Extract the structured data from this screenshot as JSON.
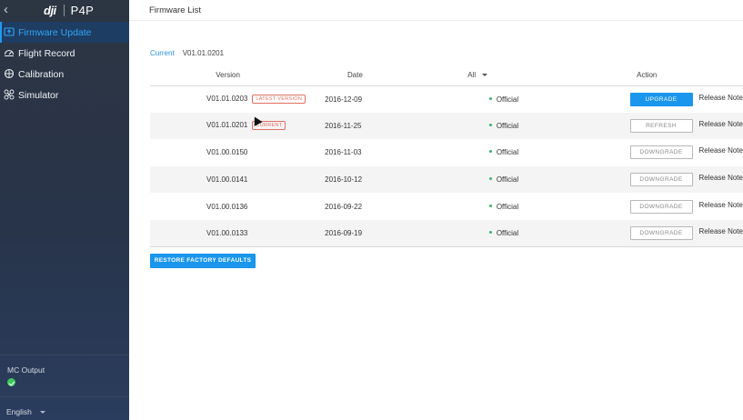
{
  "sidebar": {
    "brand_logo": "dji",
    "brand_model": "P4P",
    "nav": [
      {
        "label": "Firmware Update",
        "icon": "firmware-icon",
        "active": true
      },
      {
        "label": "Flight Record",
        "icon": "flight-record-icon",
        "active": false
      },
      {
        "label": "Calibration",
        "icon": "calibration-icon",
        "active": false
      },
      {
        "label": "Simulator",
        "icon": "simulator-icon",
        "active": false
      }
    ],
    "mc_output_label": "MC Output",
    "language": "English"
  },
  "main": {
    "title": "Firmware List",
    "current_label": "Current",
    "current_version": "V01.01.0201",
    "columns": {
      "version": "Version",
      "date": "Date",
      "filter": "All",
      "action": "Action"
    },
    "rows": [
      {
        "version": "V01.01.0203",
        "badge": "LATEST VERSION",
        "date": "2016-12-09",
        "type": "Official",
        "action": "UPGRADE",
        "note": "Release Note"
      },
      {
        "version": "V01.01.0201",
        "badge": "CURRENT",
        "date": "2016-11-25",
        "type": "Official",
        "action": "REFRESH",
        "note": "Release Note"
      },
      {
        "version": "V01.00.0150",
        "badge": "",
        "date": "2016-11-03",
        "type": "Official",
        "action": "DOWNGRADE",
        "note": "Release Note"
      },
      {
        "version": "V01.00.0141",
        "badge": "",
        "date": "2016-10-12",
        "type": "Official",
        "action": "DOWNGRADE",
        "note": "Release Note"
      },
      {
        "version": "V01.00.0136",
        "badge": "",
        "date": "2016-09-22",
        "type": "Official",
        "action": "DOWNGRADE",
        "note": "Release Note"
      },
      {
        "version": "V01.00.0133",
        "badge": "",
        "date": "2016-09-19",
        "type": "Official",
        "action": "DOWNGRADE",
        "note": "Release Note"
      }
    ],
    "restore_button": "RESTORE FACTORY DEFAULTS"
  },
  "colors": {
    "accent": "#1a96ec",
    "badge_red": "#e06e63",
    "status_green": "#37b468",
    "sidebar_bg": "#2c3542"
  }
}
